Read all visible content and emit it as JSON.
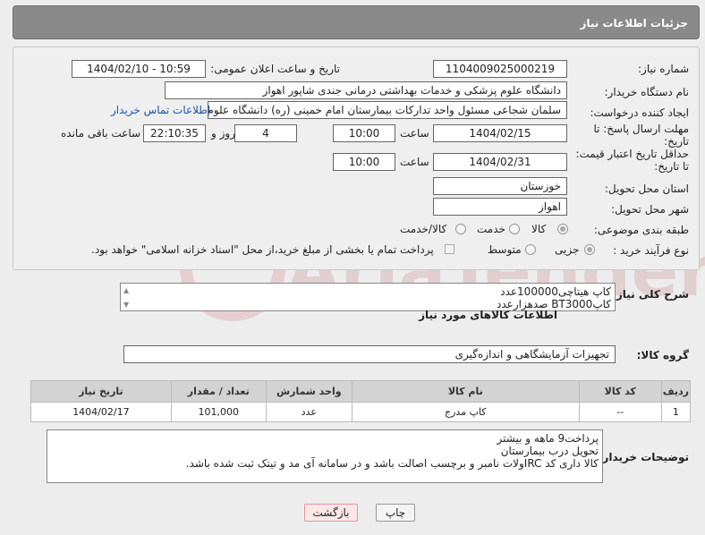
{
  "header": {
    "title": "جزئیات اطلاعات نیاز"
  },
  "fields": {
    "need_number_label": "شماره نیاز:",
    "need_number": "1104009025000219",
    "announce_label": "تاریخ و ساعت اعلان عمومی:",
    "announce_value": "1404/02/10 - 10:59",
    "buyer_org_label": "نام دستگاه خریدار:",
    "buyer_org": "دانشگاه علوم پزشکی و خدمات بهداشتی درمانی جندی شاپور اهواز",
    "creator_label": "ایجاد کننده درخواست:",
    "creator": "سلمان شجاعی مسئول واحد تدارکات بیمارستان امام خمینی (ره) دانشگاه علوم",
    "contact_link": "اطلاعات تماس خریدار",
    "send_deadline_label": "مهلت ارسال پاسخ: تا تاریخ:",
    "send_date": "1404/02/15",
    "time_label": "ساعت",
    "send_time": "10:00",
    "days_value": "4",
    "days_label": "روز و",
    "remain_time": "22:10:35",
    "remain_label": "ساعت باقی مانده",
    "price_deadline_label": "حداقل تاریخ اعتبار قیمت: تا تاریخ:",
    "price_date": "1404/02/31",
    "price_time": "10:00",
    "province_label": "استان محل تحویل:",
    "province": "خوزستان",
    "city_label": "شهر محل تحویل:",
    "city": "اهواز",
    "category_label": "طبقه بندی موضوعی:",
    "category_options": [
      "کالا",
      "خدمت",
      "کالا/خدمت"
    ],
    "process_label": "نوع فرآیند خرید :",
    "process_options": [
      "جزیی",
      "متوسط"
    ],
    "payment_note": "پرداخت تمام یا بخشی از مبلغ خرید،از محل \"اسناد خزانه اسلامی\" خواهد بود."
  },
  "general_desc": {
    "label": "شرح کلی نیاز:",
    "line1": "کاپ هیتاچی100000عدد",
    "line2": "کاپBT3000    صدهزارعدد"
  },
  "items_section": {
    "title": "اطلاعات کالاهای مورد نیاز",
    "group_label": "گروه کالا:",
    "group_value": "تجهیزات آزمایشگاهی و اندازه‌گیری",
    "columns": [
      "ردیف",
      "کد کالا",
      "نام کالا",
      "واحد شمارش",
      "تعداد / مقدار",
      "تاریخ نیاز"
    ],
    "rows": [
      [
        "1",
        "--",
        "کاپ مدرج",
        "عدد",
        "101,000",
        "1404/02/17"
      ]
    ]
  },
  "buyer_notes": {
    "label": "توضیحات خریدار:",
    "line1": "پرداخت9 ماهه و بیشتر",
    "line2": "تحویل درب بیمارستان",
    "line3": "کالا داری کد IRCولات نامبر و برچسب اصالت باشد و در سامانه آی مد و تیتک ثبت شده باشد."
  },
  "buttons": {
    "print": "چاپ",
    "back": "بازگشت"
  },
  "watermark_text": "AriaTender.neT"
}
